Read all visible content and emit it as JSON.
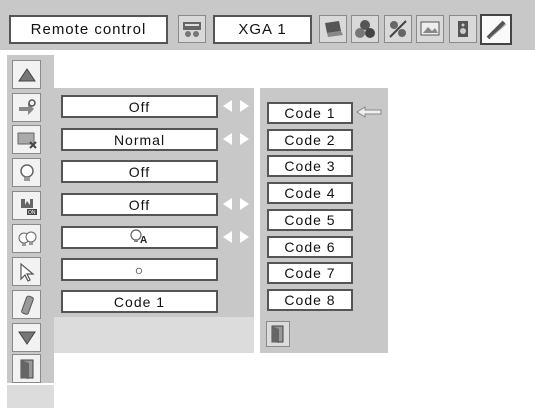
{
  "header": {
    "title": "Remote control",
    "input_source": "XGA 1"
  },
  "toolbar_icons": [
    "remote-icon",
    "laptop-icon",
    "color-balls-icon",
    "image-adjust-icon",
    "screen-icon",
    "speaker-icon",
    "setting-wrench-icon"
  ],
  "sidebar_icons": [
    "scroll-up-icon",
    "input-search-icon",
    "screen-off-icon",
    "lamp-icon",
    "power-on-icon",
    "lamp-control-icon",
    "pointer-icon",
    "remote-control-icon",
    "scroll-down-icon",
    "exit-icon"
  ],
  "settings": [
    {
      "value": "Off",
      "arrows": true
    },
    {
      "value": "Normal",
      "arrows": true
    },
    {
      "value": "Off",
      "arrows": false
    },
    {
      "value": "Off",
      "arrows": true
    },
    {
      "value": "",
      "icon": "lamp-auto-icon",
      "arrows": true
    },
    {
      "value": "○",
      "arrows": false
    },
    {
      "value": "Code 1",
      "arrows": false
    }
  ],
  "codes": [
    "Code 1",
    "Code 2",
    "Code 3",
    "Code 4",
    "Code 5",
    "Code 6",
    "Code 7",
    "Code 8"
  ],
  "selected_code": "Code 1",
  "colors": {
    "panel": "#c8c8c8",
    "light_panel": "#dcdcdc",
    "border": "#555555"
  }
}
